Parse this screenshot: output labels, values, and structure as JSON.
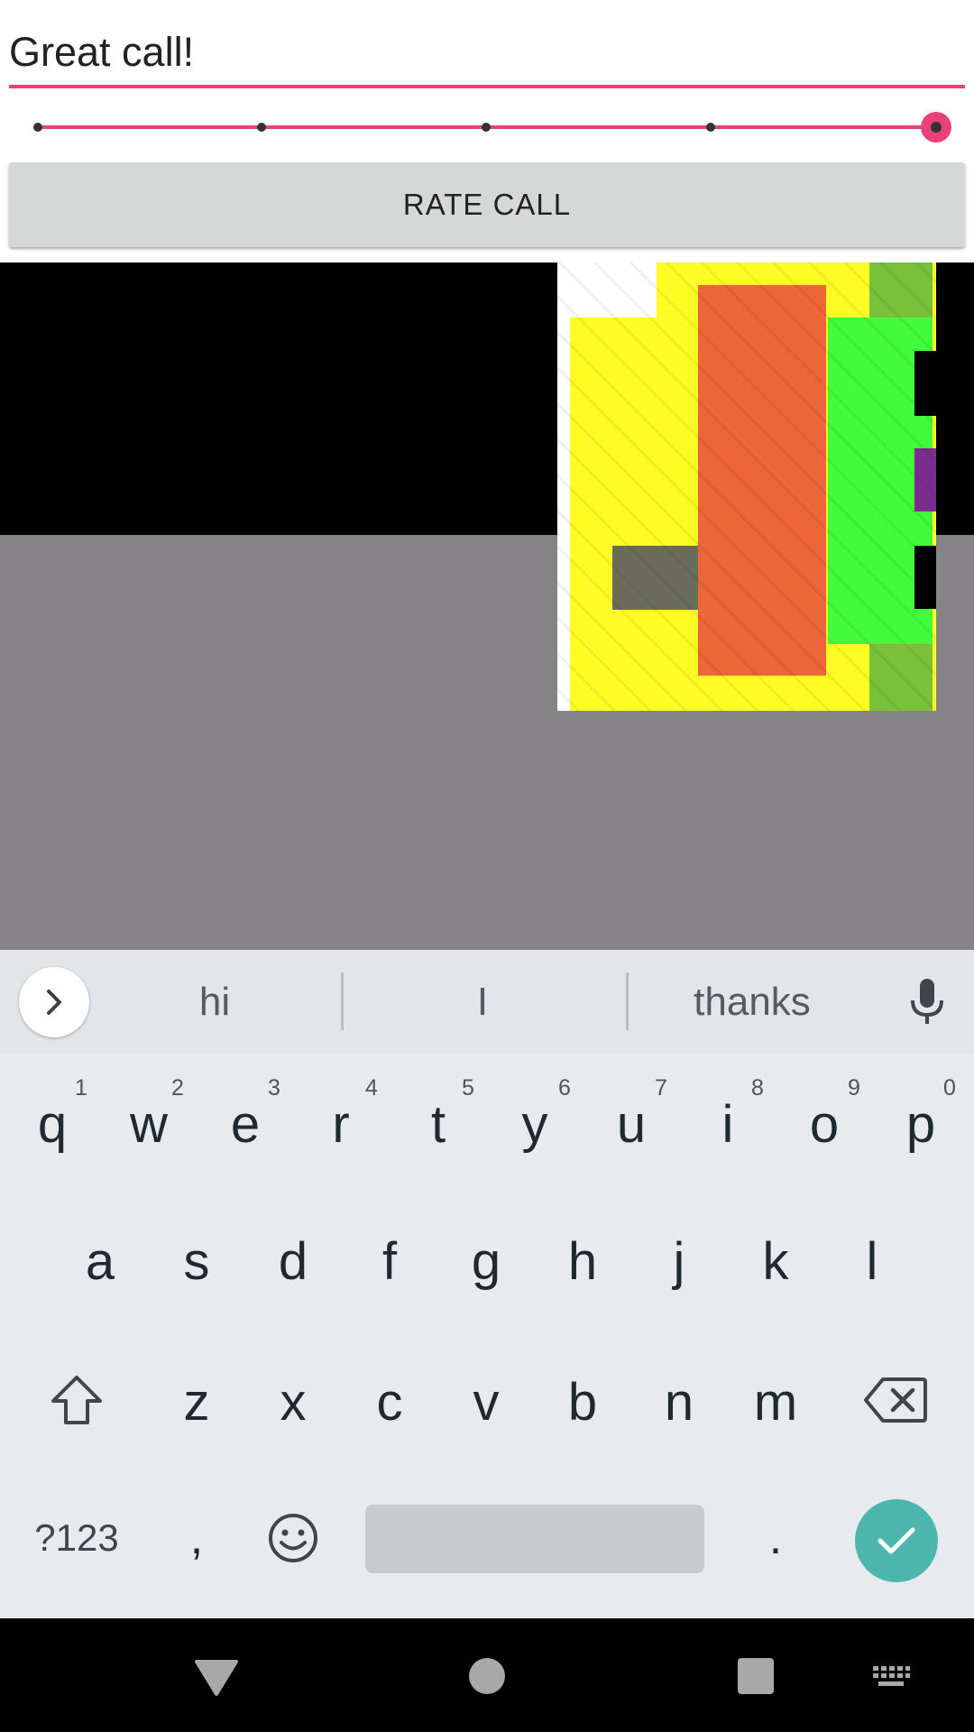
{
  "feedback": {
    "value": "Great call!",
    "placeholder": ""
  },
  "rating_slider": {
    "steps": 5,
    "selected_step": 5
  },
  "rate_button": {
    "label": "RATE CALL"
  },
  "colors": {
    "accent": "#ec407a",
    "button_bg": "#d6d7d7",
    "remote_video_top": "#000000",
    "remote_video_bottom": "#858386",
    "keyboard_bg": "#e8ebee",
    "enter_key": "#4db6ac"
  },
  "keyboard": {
    "suggestions": [
      "hi",
      "I",
      "thanks"
    ],
    "row1": [
      {
        "key": "q",
        "hint": "1"
      },
      {
        "key": "w",
        "hint": "2"
      },
      {
        "key": "e",
        "hint": "3"
      },
      {
        "key": "r",
        "hint": "4"
      },
      {
        "key": "t",
        "hint": "5"
      },
      {
        "key": "y",
        "hint": "6"
      },
      {
        "key": "u",
        "hint": "7"
      },
      {
        "key": "i",
        "hint": "8"
      },
      {
        "key": "o",
        "hint": "9"
      },
      {
        "key": "p",
        "hint": "0"
      }
    ],
    "row2": [
      "a",
      "s",
      "d",
      "f",
      "g",
      "h",
      "j",
      "k",
      "l"
    ],
    "row3": [
      "z",
      "x",
      "c",
      "v",
      "b",
      "n",
      "m"
    ],
    "symbols_label": "?123",
    "comma": ",",
    "period": ".",
    "icons": {
      "expand": "chevron-right-icon",
      "mic": "microphone-icon",
      "shift": "shift-icon",
      "backspace": "backspace-icon",
      "emoji": "emoji-icon",
      "enter": "checkmark-icon"
    }
  },
  "nav_bar": {
    "icons": [
      "back-icon",
      "home-icon",
      "recents-icon",
      "keyboard-switch-icon"
    ]
  }
}
